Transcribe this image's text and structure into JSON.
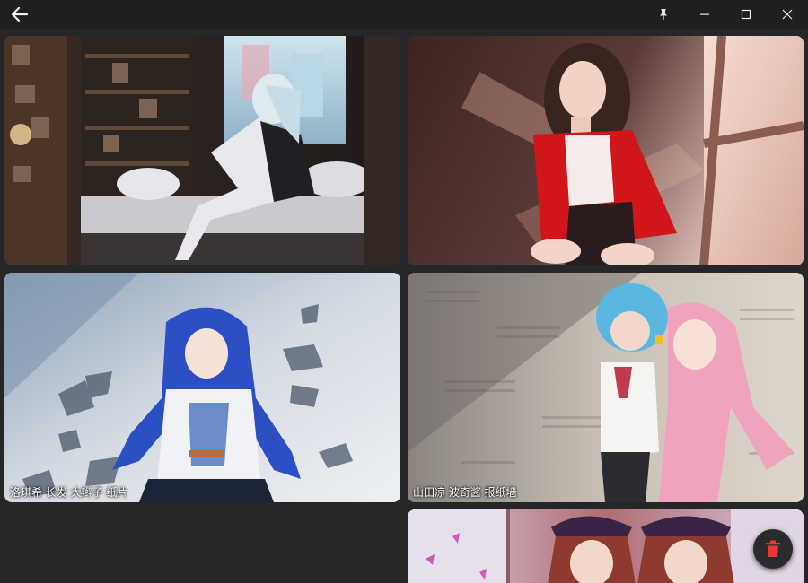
{
  "window": {
    "controls": [
      "back-icon",
      "pin-icon",
      "minimize-icon",
      "maximize-icon",
      "close-icon"
    ]
  },
  "gallery": {
    "items": [
      {
        "caption": ""
      },
      {
        "caption": ""
      },
      {
        "caption": "洛琪希 长发 大辫子 纸片"
      },
      {
        "caption": "山田凉 波奇酱 报纸墙"
      },
      {
        "caption": ""
      }
    ]
  },
  "fab": {
    "icon": "trash-icon",
    "color": "#e53935"
  }
}
